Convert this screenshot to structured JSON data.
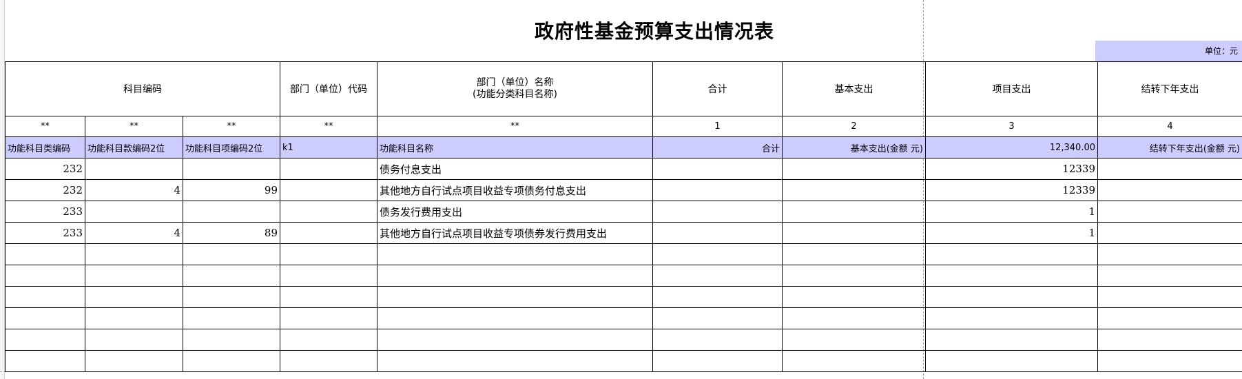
{
  "title": "政府性基金预算支出情况表",
  "unit_label": "单位：元",
  "header": {
    "subject_code": "科目编码",
    "dept_code": "部门（单位）代码",
    "dept_name_line1": "部门（单位）名称",
    "dept_name_line2": "(功能分类科目名称)",
    "total": "合计",
    "basic": "基本支出",
    "project": "项目支出",
    "carryover": "结转下年支出"
  },
  "stars_row": [
    "**",
    "**",
    "**",
    "**",
    "**",
    "1",
    "2",
    "3",
    "4"
  ],
  "field_row": [
    "功能科目类编码",
    "功能科目款编码2位",
    "功能科目项编码2位",
    "k1",
    "功能科目名称",
    "合计",
    "基本支出(金额 元)",
    "12,340.00",
    "结转下年支出(金额 元)"
  ],
  "rows": [
    [
      "232",
      "",
      "",
      "",
      "债务付息支出",
      "",
      "",
      "12339",
      ""
    ],
    [
      "232",
      "4",
      "99",
      "",
      "其他地方自行试点项目收益专项债务付息支出",
      "",
      "",
      "12339",
      ""
    ],
    [
      "233",
      "",
      "",
      "",
      "债务发行费用支出",
      "",
      "",
      "1",
      ""
    ],
    [
      "233",
      "4",
      "89",
      "",
      "其他地方自行试点项目收益专项债券发行费用支出",
      "",
      "",
      "1",
      ""
    ],
    [
      "",
      "",
      "",
      "",
      "",
      "",
      "",
      "",
      ""
    ],
    [
      "",
      "",
      "",
      "",
      "",
      "",
      "",
      "",
      ""
    ],
    [
      "",
      "",
      "",
      "",
      "",
      "",
      "",
      "",
      ""
    ],
    [
      "",
      "",
      "",
      "",
      "",
      "",
      "",
      "",
      ""
    ],
    [
      "",
      "",
      "",
      "",
      "",
      "",
      "",
      "",
      ""
    ],
    [
      "",
      "",
      "",
      "",
      "",
      "",
      "",
      "",
      ""
    ]
  ]
}
